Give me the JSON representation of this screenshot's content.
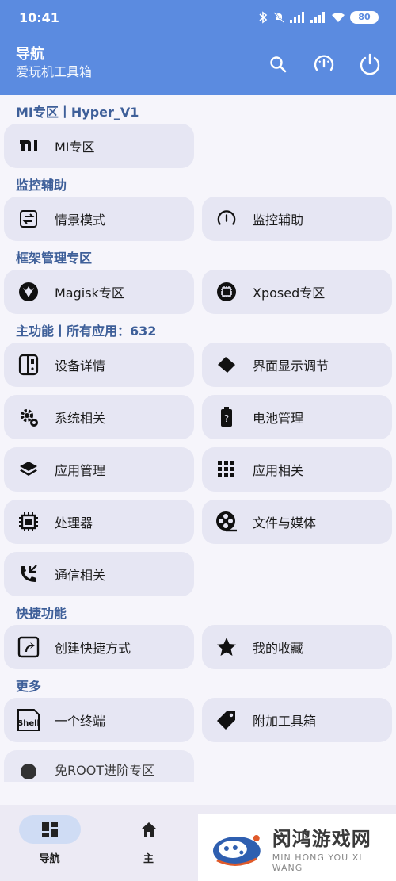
{
  "status": {
    "time": "10:41",
    "battery": "80"
  },
  "appbar": {
    "title": "导航",
    "subtitle": "爱玩机工具箱"
  },
  "sections": {
    "mi": {
      "title": "MI专区丨Hyper_V1",
      "items": [
        "MI专区"
      ]
    },
    "monitor": {
      "title": "监控辅助",
      "items": [
        "情景模式",
        "监控辅助"
      ]
    },
    "framework": {
      "title": "框架管理专区",
      "items": [
        "Magisk专区",
        "Xposed专区"
      ]
    },
    "main": {
      "title": "主功能丨所有应用：632",
      "items": [
        "设备详情",
        "界面显示调节",
        "系统相关",
        "电池管理",
        "应用管理",
        "应用相关",
        "处理器",
        "文件与媒体",
        "通信相关"
      ]
    },
    "shortcut": {
      "title": "快捷功能",
      "items": [
        "创建快捷方式",
        "我的收藏"
      ]
    },
    "more": {
      "title": "更多",
      "items": [
        "一个终端",
        "附加工具箱",
        "免ROOT进阶专区"
      ]
    }
  },
  "bottom_nav": {
    "items": [
      {
        "label": "导航",
        "active": true
      },
      {
        "label": "主"
      }
    ]
  },
  "watermark": {
    "cn": "闵鸿游戏网",
    "en": "MIN HONG YOU XI WANG"
  },
  "colors": {
    "primary": "#5b8be0",
    "card": "#e6e6f3",
    "section_title": "#3e5f99",
    "background": "#f6f5fb"
  },
  "icons": {
    "actions": [
      "search-icon",
      "speedometer-icon",
      "power-icon"
    ],
    "nav": [
      "dashboard-icon",
      "home-icon"
    ]
  }
}
